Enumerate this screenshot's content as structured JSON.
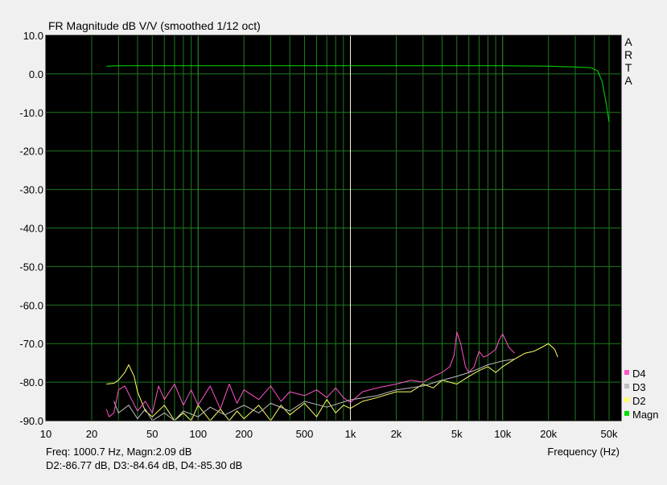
{
  "window": {
    "title": "FR Magnitude dB V/V (smoothed 1/12 oct)",
    "brand_letters": [
      "A",
      "R",
      "T",
      "A"
    ]
  },
  "readout": {
    "line1": "Freq: 1000.7 Hz, Magn:2.09 dB",
    "line2": "D2:-86.77 dB, D3:-84.64 dB, D4:-85.30 dB"
  },
  "chart_data": {
    "type": "line",
    "title": "FR Magnitude dB V/V (smoothed 1/12 oct)",
    "xlabel": "Frequency (Hz)",
    "ylabel": "",
    "x_scale": "log",
    "xlim": [
      10,
      60000
    ],
    "ylim": [
      -90,
      10
    ],
    "grid": true,
    "background": "#000000",
    "grid_color": "#1f7a1f",
    "legend_position": "bottom-right",
    "cursor_x": 1000.7,
    "xticks": [
      {
        "value": 10,
        "label": "10"
      },
      {
        "value": 20,
        "label": "20"
      },
      {
        "value": 50,
        "label": "50"
      },
      {
        "value": 100,
        "label": "100"
      },
      {
        "value": 200,
        "label": "200"
      },
      {
        "value": 500,
        "label": "500"
      },
      {
        "value": 1000,
        "label": "1k"
      },
      {
        "value": 2000,
        "label": "2k"
      },
      {
        "value": 5000,
        "label": "5k"
      },
      {
        "value": 10000,
        "label": "10k"
      },
      {
        "value": 20000,
        "label": "20k"
      },
      {
        "value": 50000,
        "label": "50k"
      }
    ],
    "yticks": [
      {
        "value": 10,
        "label": "10.0"
      },
      {
        "value": 0,
        "label": "0.0"
      },
      {
        "value": -10,
        "label": "-10.0"
      },
      {
        "value": -20,
        "label": "-20.0"
      },
      {
        "value": -30,
        "label": "-30.0"
      },
      {
        "value": -40,
        "label": "-40.0"
      },
      {
        "value": -50,
        "label": "-50.0"
      },
      {
        "value": -60,
        "label": "-60.0"
      },
      {
        "value": -70,
        "label": "-70.0"
      },
      {
        "value": -80,
        "label": "-80.0"
      },
      {
        "value": -90,
        "label": "-90.0"
      }
    ],
    "series": [
      {
        "name": "Magn",
        "color": "#00e000",
        "x": [
          25,
          30,
          50,
          100,
          200,
          500,
          1000,
          2000,
          5000,
          10000,
          20000,
          30000,
          38000,
          42000,
          45000,
          48000,
          50000
        ],
        "y": [
          2.0,
          2.1,
          2.1,
          2.1,
          2.1,
          2.1,
          2.1,
          2.1,
          2.1,
          2.1,
          2.0,
          1.8,
          1.6,
          0.8,
          -2.0,
          -8.0,
          -12.5
        ]
      },
      {
        "name": "D2",
        "color": "#ffff66",
        "x": [
          25,
          28,
          30,
          33,
          35,
          38,
          40,
          45,
          50,
          60,
          70,
          80,
          90,
          100,
          120,
          140,
          160,
          180,
          200,
          250,
          300,
          350,
          400,
          500,
          600,
          700,
          800,
          900,
          1000,
          1200,
          1500,
          2000,
          2500,
          3000,
          3500,
          4000,
          5000,
          6000,
          7000,
          8000,
          9000,
          10000,
          12000,
          14000,
          16000,
          18000,
          20000,
          22000,
          23000
        ],
        "y": [
          -80.5,
          -80.3,
          -79.5,
          -77.5,
          -75.5,
          -78.5,
          -82.5,
          -87.5,
          -89.0,
          -86.0,
          -90.0,
          -88.0,
          -90.0,
          -86.0,
          -90.0,
          -87.0,
          -90.0,
          -87.5,
          -89.5,
          -86.0,
          -90.0,
          -86.0,
          -88.5,
          -85.5,
          -89.0,
          -84.5,
          -88.0,
          -86.0,
          -86.8,
          -85.0,
          -84.0,
          -82.5,
          -82.5,
          -80.5,
          -81.5,
          -79.5,
          -80.5,
          -78.5,
          -77.0,
          -76.0,
          -77.5,
          -76.0,
          -74.0,
          -72.5,
          -72.0,
          -71.0,
          -70.0,
          -71.5,
          -73.5
        ]
      },
      {
        "name": "D3",
        "color": "#c0c0c0",
        "x": [
          28,
          30,
          35,
          40,
          45,
          50,
          60,
          70,
          80,
          100,
          120,
          150,
          200,
          250,
          300,
          400,
          500,
          700,
          1000,
          1500,
          2000,
          3000,
          4000,
          5000,
          6000,
          7000,
          8000,
          10000,
          12000
        ],
        "y": [
          -85.0,
          -88.0,
          -86.0,
          -89.5,
          -87.0,
          -90.0,
          -88.0,
          -90.0,
          -87.5,
          -89.0,
          -86.5,
          -88.5,
          -86.0,
          -88.0,
          -85.5,
          -87.5,
          -85.0,
          -86.5,
          -84.6,
          -83.5,
          -82.0,
          -81.0,
          -79.5,
          -78.5,
          -77.5,
          -76.5,
          -75.5,
          -74.5,
          -74.0
        ]
      },
      {
        "name": "D4",
        "color": "#ff55cc",
        "x": [
          25,
          26,
          28,
          30,
          33,
          36,
          40,
          45,
          50,
          55,
          60,
          70,
          80,
          90,
          100,
          120,
          140,
          160,
          180,
          200,
          250,
          300,
          350,
          400,
          500,
          600,
          700,
          800,
          900,
          1000,
          1200,
          1500,
          2000,
          2500,
          3000,
          3500,
          4000,
          4500,
          4800,
          5000,
          5300,
          5700,
          6000,
          6500,
          7000,
          7500,
          8000,
          9000,
          9500,
          10000,
          11000,
          12000
        ],
        "y": [
          -87.0,
          -89.0,
          -88.0,
          -82.0,
          -81.0,
          -84.0,
          -87.5,
          -85.0,
          -88.0,
          -81.0,
          -84.5,
          -80.5,
          -86.0,
          -82.0,
          -86.0,
          -81.0,
          -87.0,
          -80.5,
          -85.5,
          -82.0,
          -84.5,
          -81.0,
          -85.0,
          -82.5,
          -83.5,
          -82.0,
          -84.0,
          -81.5,
          -84.0,
          -85.3,
          -82.5,
          -81.5,
          -80.5,
          -79.5,
          -80.0,
          -78.5,
          -77.5,
          -76.0,
          -73.0,
          -67.0,
          -70.0,
          -76.0,
          -77.5,
          -76.0,
          -72.0,
          -73.5,
          -73.0,
          -71.5,
          -69.0,
          -67.5,
          -71.0,
          -72.5
        ]
      }
    ]
  }
}
